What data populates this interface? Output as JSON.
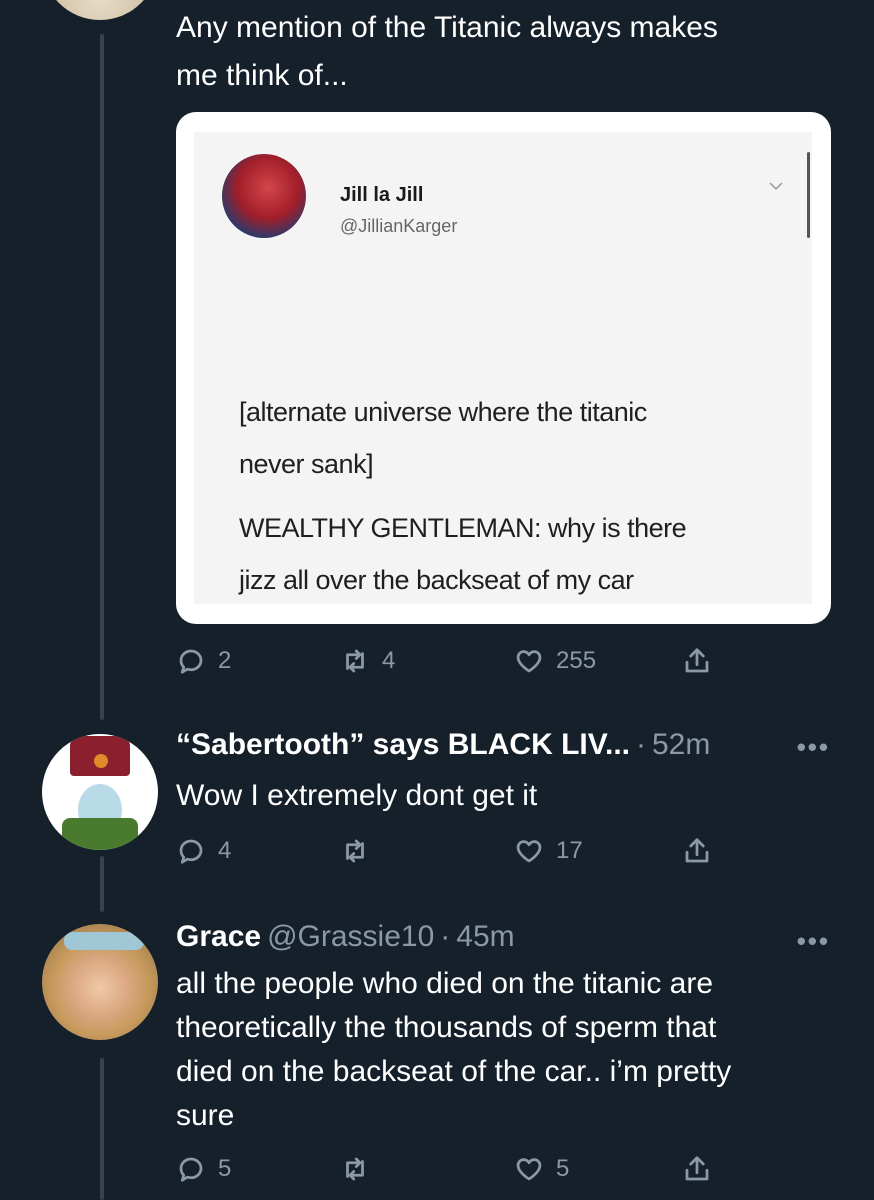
{
  "main_tweet": {
    "text_lines": [
      "Any mention of the Titanic always makes",
      "me think of..."
    ],
    "embedded_image": {
      "name": "Jill la Jill",
      "handle": "@JillianKarger",
      "text_lines": [
        "[alternate universe where the titanic",
        "never sank]",
        "WEALTHY GENTLEMAN: why is there",
        "jizz all over the backseat of my car"
      ]
    },
    "actions": {
      "replies": "2",
      "retweets": "4",
      "likes": "255"
    }
  },
  "reply_1": {
    "name": "“Sabertooth” says BLACK LIV...",
    "separator": "·",
    "time": "52m",
    "more": "•••",
    "text": "Wow I extremely dont get it",
    "actions": {
      "replies": "4",
      "retweets": "",
      "likes": "17"
    }
  },
  "reply_2": {
    "name": "Grace",
    "handle": "@Grassie10",
    "separator": "·",
    "time": "45m",
    "more": "•••",
    "text_lines": [
      "all the people who died on the titanic are",
      "theoretically the thousands of sperm that",
      "died on the backseat of the car.. i’m pretty",
      "sure"
    ],
    "actions": {
      "replies": "5",
      "retweets": "",
      "likes": "5"
    }
  },
  "colors": {
    "background": "#15202b",
    "muted": "#8b98a5",
    "thread_line": "#38444d"
  }
}
